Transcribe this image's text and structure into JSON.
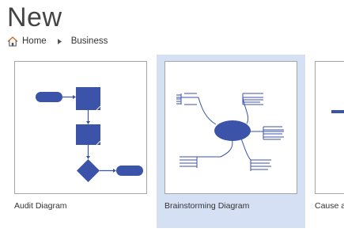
{
  "page": {
    "title": "New"
  },
  "breadcrumb": {
    "home_label": "Home",
    "current_label": "Business"
  },
  "colors": {
    "shape_fill": "#3b53a8",
    "connector": "#3b53a8",
    "selected_bg": "#d6e0f5",
    "thumb_border": "#a6a6a6"
  },
  "templates": [
    {
      "label": "Audit Diagram",
      "selected": false
    },
    {
      "label": "Brainstorming Diagram",
      "selected": true
    },
    {
      "label": "Cause and Effect Diagram",
      "selected": false
    }
  ]
}
